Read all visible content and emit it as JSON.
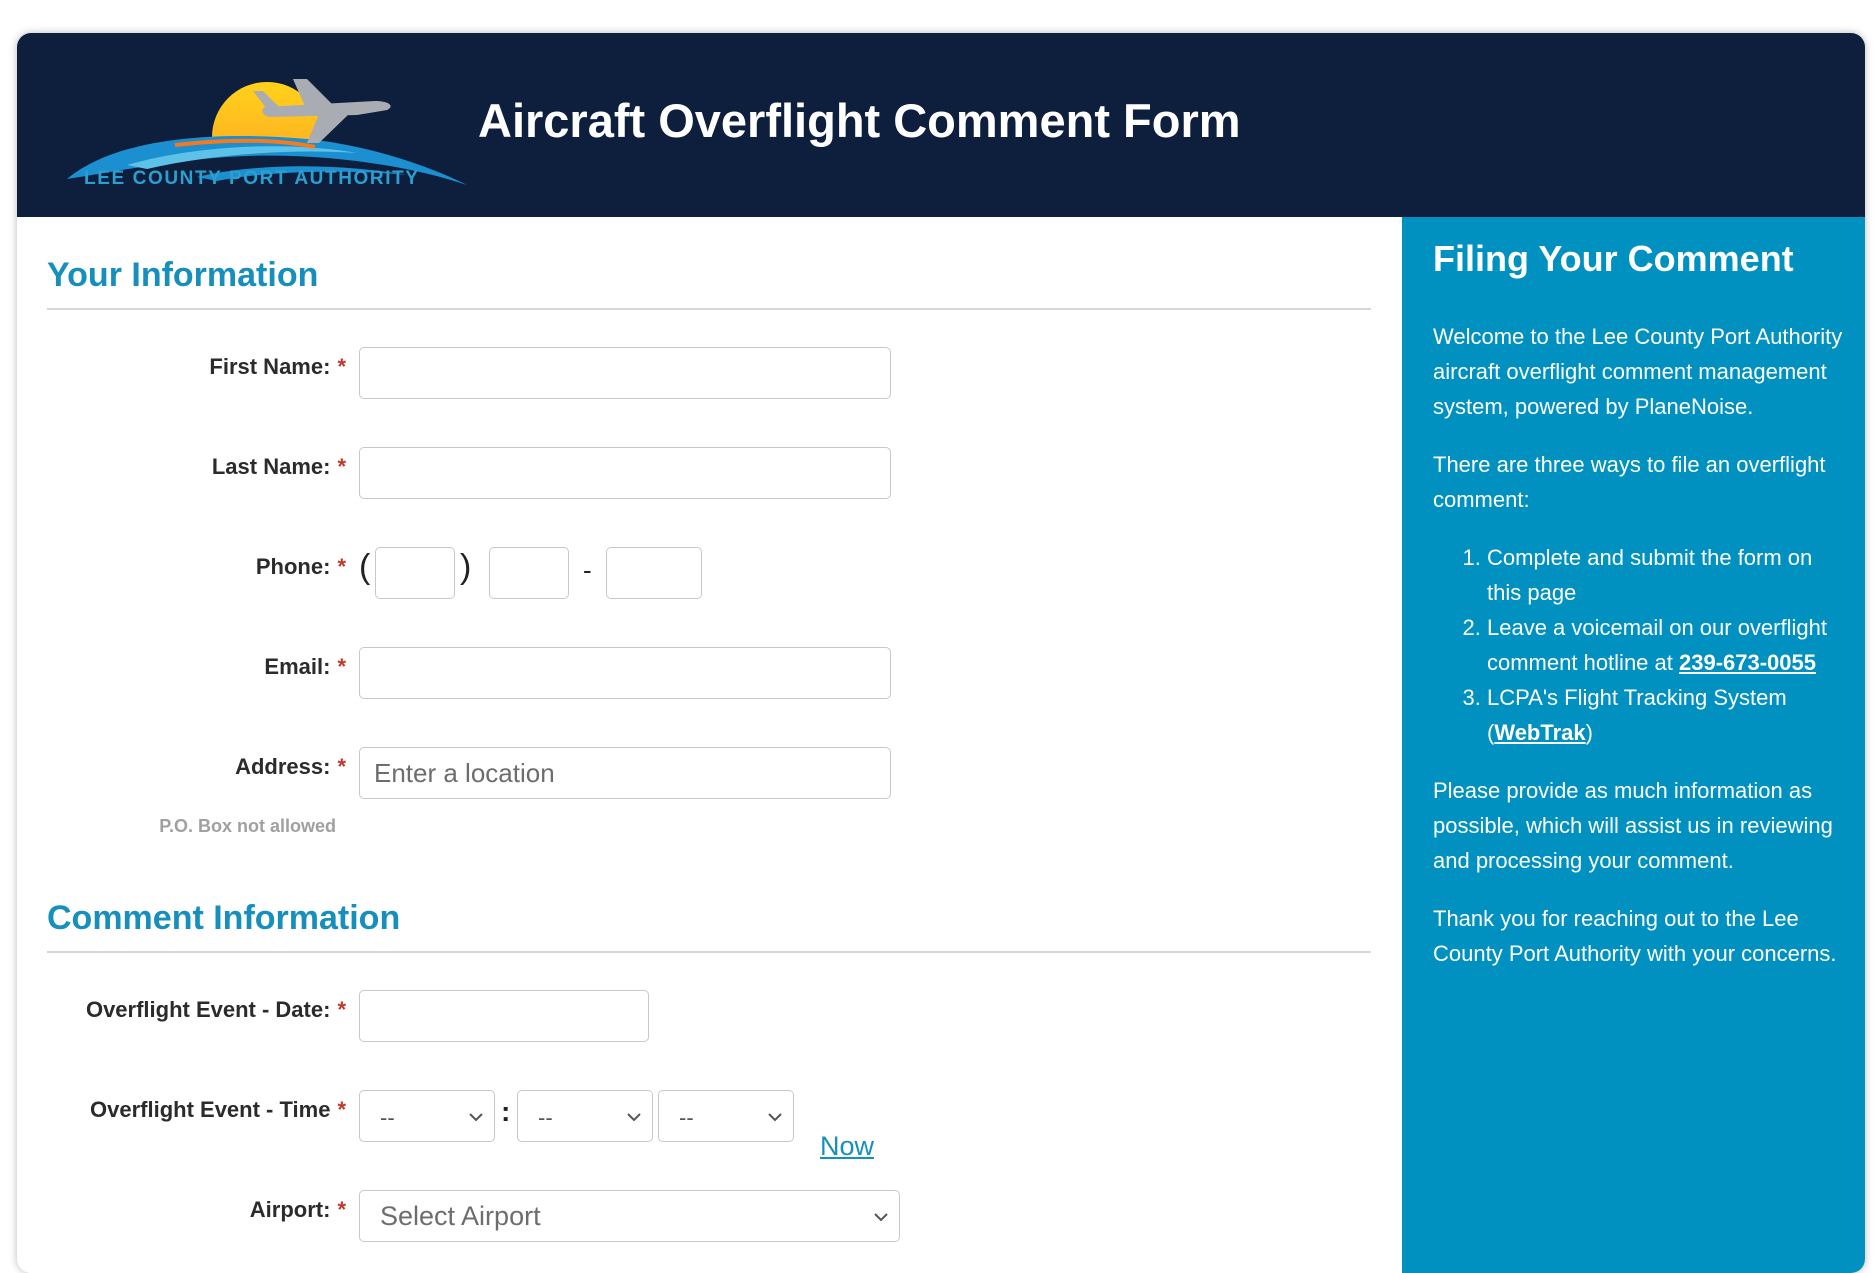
{
  "header": {
    "logo_text": "LEE COUNTY PORT AUTHORITY",
    "title": "Aircraft Overflight Comment Form"
  },
  "your_info": {
    "title": "Your Information",
    "first_name_label": "First Name:",
    "last_name_label": "Last Name:",
    "phone_label": "Phone:",
    "phone_open_paren": "(",
    "phone_close_paren": ")",
    "phone_dash": "-",
    "email_label": "Email:",
    "address_label": "Address:",
    "address_hint": "P.O. Box not allowed",
    "address_placeholder": "Enter a location",
    "required_mark": "*"
  },
  "comment_info": {
    "title": "Comment Information",
    "date_label": "Overflight Event - Date:",
    "time_label": "Overflight Event - Time",
    "hour_value": "--",
    "minute_value": "--",
    "ampm_value": "--",
    "time_separator": ":",
    "now_link": "Now",
    "airport_label": "Airport:",
    "airport_value": "Select Airport"
  },
  "sidebar": {
    "title": "Filing Your Comment",
    "intro": "Welcome to the Lee County Port Authority aircraft overflight comment management system, powered by PlaneNoise.",
    "ways_intro": "There are three ways to file an overflight comment:",
    "way1": "Complete and submit the form on this page",
    "way2_prefix": "Leave a voicemail on our overflight comment hotline at ",
    "hotline": "239-673-0055",
    "way3_prefix": "LCPA's Flight Tracking System (",
    "webtrak": "WebTrak",
    "way3_suffix": ")",
    "more_info": "Please provide as much information as possible, which will assist us in reviewing and processing your comment.",
    "thanks": "Thank you for reaching out to the Lee County Port Authority with your concerns."
  },
  "colors": {
    "header_bg": "#0e1f3e",
    "accent": "#178fbd",
    "sidebar_bg": "#0091c0",
    "required": "#c0392b"
  }
}
